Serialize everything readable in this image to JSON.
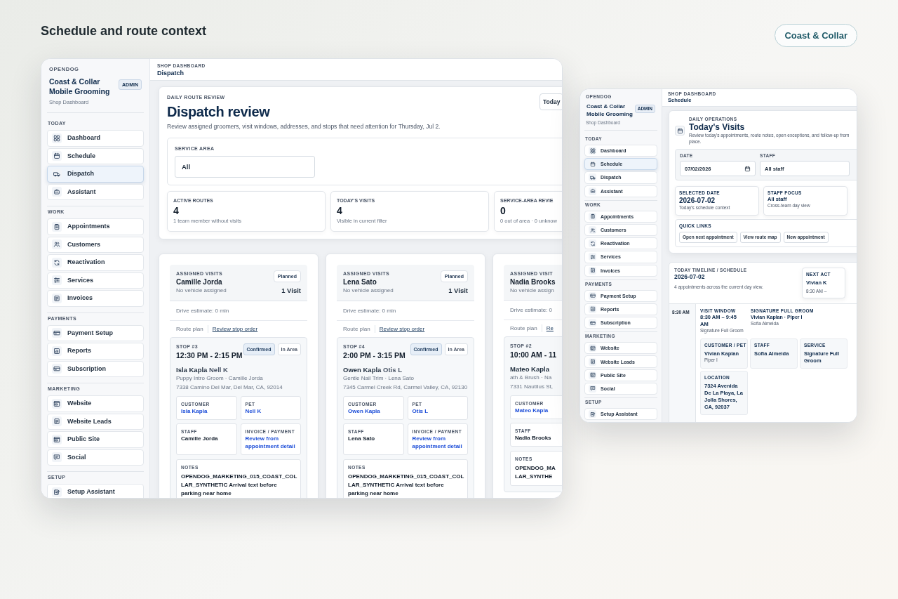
{
  "page_title": "Schedule and route context",
  "brand_pill": "Coast & Collar",
  "screens": [
    {
      "kind": "dispatch",
      "sidebar": {
        "org": "OPENDOG",
        "shop_name": "Coast & Collar Mobile Grooming",
        "role_badge": "ADMIN",
        "subtitle": "Shop Dashboard",
        "sections": [
          {
            "title": "TODAY",
            "items": [
              {
                "label": "Dashboard",
                "selected": false
              },
              {
                "label": "Schedule",
                "selected": false
              },
              {
                "label": "Dispatch",
                "selected": true
              },
              {
                "label": "Assistant",
                "selected": false
              }
            ]
          },
          {
            "title": "WORK",
            "items": [
              {
                "label": "Appointments",
                "selected": false
              },
              {
                "label": "Customers",
                "selected": false
              },
              {
                "label": "Reactivation",
                "selected": false
              },
              {
                "label": "Services",
                "selected": false
              },
              {
                "label": "Invoices",
                "selected": false
              }
            ]
          },
          {
            "title": "PAYMENTS",
            "items": [
              {
                "label": "Payment Setup",
                "selected": false
              },
              {
                "label": "Reports",
                "selected": false
              },
              {
                "label": "Subscription",
                "selected": false
              }
            ]
          },
          {
            "title": "MARKETING",
            "items": [
              {
                "label": "Website",
                "selected": false
              },
              {
                "label": "Website Leads",
                "selected": false
              },
              {
                "label": "Public Site",
                "selected": false
              },
              {
                "label": "Social",
                "selected": false
              }
            ]
          },
          {
            "title": "SETUP",
            "items": [
              {
                "label": "Setup Assistant",
                "selected": false
              }
            ]
          }
        ]
      },
      "topbar": {
        "eyebrow": "SHOP DASHBOARD",
        "title": "Dispatch"
      },
      "dispatch": {
        "header": {
          "eyebrow": "DAILY ROUTE REVIEW",
          "title": "Dispatch review",
          "description": "Review assigned groomers, visit windows, addresses, and stops that need attention for Thursday, Jul 2.",
          "button": "Today"
        },
        "service_area": {
          "label": "SERVICE AREA",
          "value": "All"
        },
        "stats": [
          {
            "label": "ACTIVE ROUTES",
            "value": "4",
            "note": "1 team member without visits"
          },
          {
            "label": "TODAY'S VISITS",
            "value": "4",
            "note": "Visible in current filter"
          },
          {
            "label": "SERVICE-AREA REVIE",
            "value": "0",
            "note": "0 out of area · 0 unknow"
          }
        ],
        "routes": [
          {
            "eyebrow": "ASSIGNED VISITS",
            "staff_name": "Camille Jorda",
            "vehicle": "No vehicle assigned",
            "status": "Planned",
            "visits": "1 Visit",
            "drive_estimate": "Drive estimate: 0 min",
            "route_label": "Route plan",
            "route_link": "Review stop order",
            "stop": {
              "number": "STOP #3",
              "time": "12:30 PM - 2:15 PM",
              "badges": [
                {
                  "label": "Confirmed",
                  "kind": "status"
                },
                {
                  "label": "In Area",
                  "kind": "area"
                }
              ],
              "customer": "Isla Kapla",
              "pet": "Nell K",
              "service": "Puppy Intro Groom · Camille Jorda",
              "address": "7338 Camino Del Mar, Del Mar, CA, 92014",
              "details": [
                {
                  "label": "CUSTOMER",
                  "value": "Isla Kapla",
                  "kind": "link"
                },
                {
                  "label": "STAFF",
                  "value": "Camille Jorda",
                  "kind": "text"
                },
                {
                  "label": "PET",
                  "value": "Nell K",
                  "kind": "link"
                },
                {
                  "label": "INVOICE / PAYMENT",
                  "value": "Review from appointment detail",
                  "kind": "link"
                }
              ],
              "notes": {
                "label": "NOTES",
                "lines": [
                  "OPENDOG_MARKETING_015_COAST_COL",
                  "LAR_SYNTHETIC Arrival text before",
                  "parking near home"
                ]
              }
            }
          },
          {
            "eyebrow": "ASSIGNED VISITS",
            "staff_name": "Lena Sato",
            "vehicle": "No vehicle assigned",
            "status": "Planned",
            "visits": "1 Visit",
            "drive_estimate": "Drive estimate: 0 min",
            "route_label": "Route plan",
            "route_link": "Review stop order",
            "stop": {
              "number": "STOP #4",
              "time": "2:00 PM - 3:15 PM",
              "badges": [
                {
                  "label": "Confirmed",
                  "kind": "status"
                },
                {
                  "label": "In Area",
                  "kind": "area"
                }
              ],
              "customer": "Owen Kapla",
              "pet": "Otis L",
              "service": "Gentle Nail Trim · Lena Sato",
              "address": "7345 Carmel Creek Rd, Carmel Valley, CA, 92130",
              "details": [
                {
                  "label": "CUSTOMER",
                  "value": "Owen Kapla",
                  "kind": "link"
                },
                {
                  "label": "STAFF",
                  "value": "Lena Sato",
                  "kind": "text"
                },
                {
                  "label": "PET",
                  "value": "Otis L",
                  "kind": "link"
                },
                {
                  "label": "INVOICE / PAYMENT",
                  "value": "Review from appointment detail",
                  "kind": "link"
                }
              ],
              "notes": {
                "label": "NOTES",
                "lines": [
                  "OPENDOG_MARKETING_015_COAST_COL",
                  "LAR_SYNTHETIC Arrival text before",
                  "parking near home"
                ]
              }
            }
          },
          {
            "eyebrow": "ASSIGNED VISIT",
            "staff_name": "Nadia Brooks",
            "vehicle": "No vehicle assign",
            "drive_estimate": "Drive estimate: 0",
            "route_label": "Route plan",
            "route_link": "Re",
            "stop": {
              "number": "STOP #2",
              "time": "10:00 AM - 11",
              "customer": "Mateo Kapla",
              "service": "ath & Brush · Na",
              "address": "7331 Nautilus St,",
              "details": [
                {
                  "label": "CUSTOMER",
                  "value": "Mateo Kapla",
                  "kind": "link"
                },
                {
                  "label": "STAFF",
                  "value": "Nadia Brooks",
                  "kind": "text"
                }
              ],
              "notes": {
                "label": "NOTES",
                "lines": [
                  "OPENDOG_MA",
                  "LAR_SYNTHE"
                ]
              }
            }
          }
        ]
      }
    },
    {
      "kind": "schedule",
      "sidebar": {
        "org": "OPENDOG",
        "shop_name": "Coast & Collar Mobile Grooming",
        "role_badge": "ADMIN",
        "subtitle": "Shop Dashboard",
        "sections": [
          {
            "title": "TODAY",
            "items": [
              {
                "label": "Dashboard",
                "selected": false
              },
              {
                "label": "Schedule",
                "selected": true
              },
              {
                "label": "Dispatch",
                "selected": false
              },
              {
                "label": "Assistant",
                "selected": false
              }
            ]
          },
          {
            "title": "WORK",
            "items": [
              {
                "label": "Appointments",
                "selected": false
              },
              {
                "label": "Customers",
                "selected": false
              },
              {
                "label": "Reactivation",
                "selected": false
              },
              {
                "label": "Services",
                "selected": false
              },
              {
                "label": "Invoices",
                "selected": false
              }
            ]
          },
          {
            "title": "PAYMENTS",
            "items": [
              {
                "label": "Payment Setup",
                "selected": false
              },
              {
                "label": "Reports",
                "selected": false
              },
              {
                "label": "Subscription",
                "selected": false
              }
            ]
          },
          {
            "title": "MARKETING",
            "items": [
              {
                "label": "Website",
                "selected": false
              },
              {
                "label": "Website Leads",
                "selected": false
              },
              {
                "label": "Public Site",
                "selected": false
              },
              {
                "label": "Social",
                "selected": false
              }
            ]
          },
          {
            "title": "SETUP",
            "items": [
              {
                "label": "Setup Assistant",
                "selected": false
              }
            ]
          }
        ]
      },
      "topbar": {
        "eyebrow": "SHOP DASHBOARD",
        "title": "Schedule"
      },
      "schedule": {
        "header": {
          "eyebrow": "DAILY OPERATIONS",
          "title": "Today's Visits",
          "description_lines": [
            "Review today's appointments, route notes, open exceptions, and follow-up from",
            "place."
          ]
        },
        "filters": [
          {
            "label": "DATE",
            "value": "07/02/2026",
            "kind": "date"
          },
          {
            "label": "STAFF",
            "value": "All staff",
            "kind": "select"
          }
        ],
        "summary": [
          {
            "label": "SELECTED DATE",
            "value": "2026-07-02",
            "note": "Today's schedule context",
            "kind": "large"
          },
          {
            "label": "STAFF FOCUS",
            "value": "All staff",
            "note": "Cross-team day view",
            "kind": "small"
          }
        ],
        "quick_links": {
          "label": "QUICK LINKS",
          "buttons": [
            "Open next appointment",
            "View route map",
            "New appointment"
          ]
        },
        "timeline": {
          "eyebrow": "TODAY TIMELINE / SCHEDULE",
          "date": "2026-07-02",
          "summary": "4 appointments across the current day view.",
          "next": {
            "label": "NEXT ACT",
            "name": "Vivian K",
            "time": "8:30 AM –"
          },
          "entries": [
            {
              "time": "8:30 AM",
              "window_label": "VISIT WINDOW",
              "window": "8:30 AM – 9:45 AM",
              "window_service": "Signature Full Groom",
              "service_label": "SIGNATURE FULL GROOM",
              "who": "Vivian Kaplan · Piper I",
              "staff": "Sofia Almeida",
              "details": [
                {
                  "label": "CUSTOMER / PET",
                  "value": "Vivian Kaplan",
                  "note": "Piper I"
                },
                {
                  "label": "STAFF",
                  "value": "Sofia Almeida"
                },
                {
                  "label": "SERVICE",
                  "value": "Signature Full Groom"
                },
                {
                  "label": "LOCATION",
                  "value": "7324 Avenida De La Playa, La Jolla Shores, CA, 92037"
                }
              ]
            }
          ]
        }
      }
    }
  ]
}
